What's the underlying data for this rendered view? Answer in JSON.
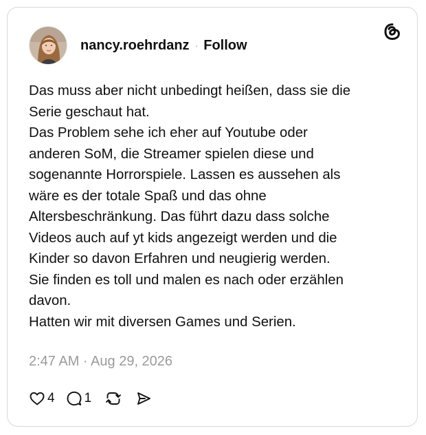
{
  "post": {
    "username": "nancy.roehrdanz",
    "separator": "·",
    "follow_label": "Follow",
    "body_lines": [
      "Das muss aber nicht unbedingt heißen, dass sie die",
      "Serie geschaut hat.",
      "Das Problem sehe ich eher auf Youtube oder",
      "anderen SoM, die Streamer spielen diese und",
      "sogenannte Horrorspiele. Lassen es aussehen als",
      "wäre es der totale Spaß und das ohne",
      "Altersbeschränkung. Das führt dazu dass solche",
      "Videos auch auf yt kids angezeigt werden und die",
      "Kinder so davon Erfahren und neugierig werden.",
      "Sie finden es toll und malen es nach oder erzählen",
      "davon.",
      "Hatten wir mit diversen Games und Serien."
    ],
    "timestamp": "2:47 AM · Aug 29, 2026",
    "likes": "4",
    "replies": "1"
  },
  "icons": {
    "brand": "threads-logo-icon",
    "like": "heart-icon",
    "reply": "comment-bubble-icon",
    "repost": "repost-icon",
    "share": "send-icon"
  },
  "colors": {
    "text": "#101010",
    "muted": "#9a9a9a",
    "border": "#d9d9d9"
  }
}
